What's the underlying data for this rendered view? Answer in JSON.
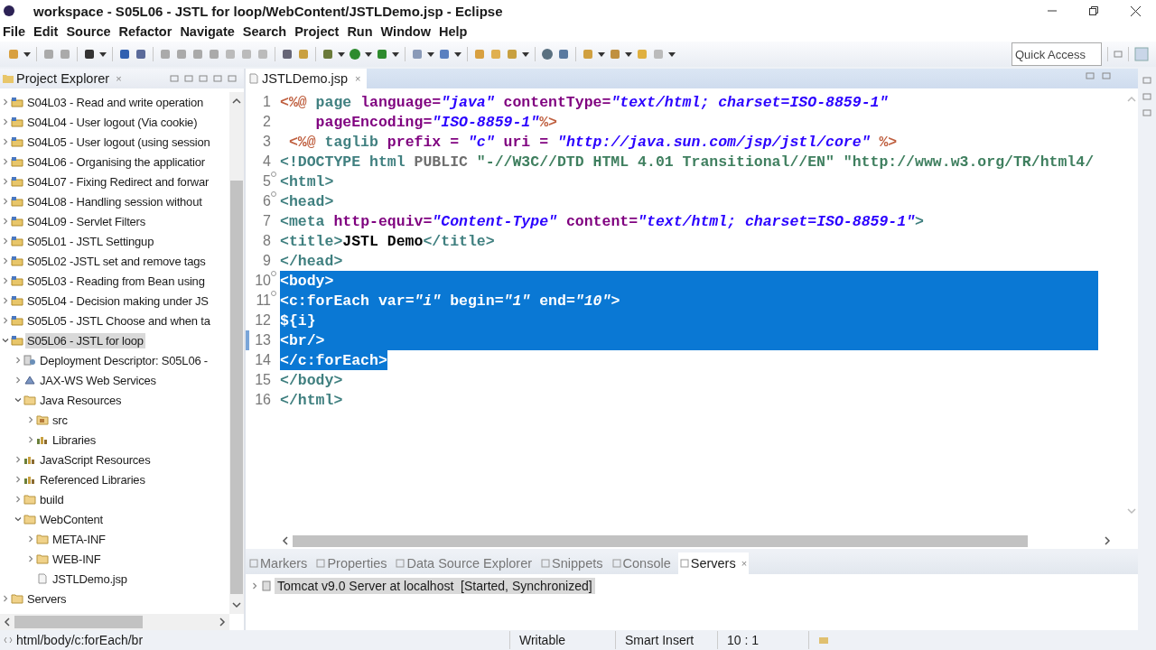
{
  "window": {
    "title": "workspace - S05L06 - JSTL for loop/WebContent/JSTLDemo.jsp - Eclipse"
  },
  "menu": [
    "File",
    "Edit",
    "Source",
    "Refactor",
    "Navigate",
    "Search",
    "Project",
    "Run",
    "Window",
    "Help"
  ],
  "quick_access": {
    "placeholder": "Quick Access"
  },
  "project_explorer": {
    "title": "Project Explorer",
    "close": "×",
    "items": [
      {
        "label": "S04L03 - Read and write operation",
        "kind": "project",
        "expanded": false,
        "selected": false
      },
      {
        "label": "S04L04 - User logout (Via cookie)",
        "kind": "project",
        "expanded": false,
        "selected": false
      },
      {
        "label": "S04L05 - User logout (using session",
        "kind": "project",
        "expanded": false,
        "selected": false
      },
      {
        "label": "S04L06 - Organising the applicatior",
        "kind": "project",
        "expanded": false,
        "selected": false
      },
      {
        "label": "S04L07 - Fixing Redirect and forwar",
        "kind": "project",
        "expanded": false,
        "selected": false
      },
      {
        "label": "S04L08 - Handling session without",
        "kind": "project",
        "expanded": false,
        "selected": false
      },
      {
        "label": "S04L09 - Servlet Filters",
        "kind": "project",
        "expanded": false,
        "selected": false
      },
      {
        "label": "S05L01 - JSTL Settingup",
        "kind": "project",
        "expanded": false,
        "selected": false
      },
      {
        "label": "S05L02 -JSTL set and remove tags",
        "kind": "project",
        "expanded": false,
        "selected": false
      },
      {
        "label": "S05L03 - Reading from Bean using",
        "kind": "project",
        "expanded": false,
        "selected": false
      },
      {
        "label": "S05L04 - Decision making under JS",
        "kind": "project",
        "expanded": false,
        "selected": false
      },
      {
        "label": "S05L05 - JSTL Choose and when ta",
        "kind": "project",
        "expanded": false,
        "selected": false
      },
      {
        "label": "S05L06 - JSTL for loop",
        "kind": "project",
        "expanded": true,
        "selected": true,
        "children": [
          {
            "label": "Deployment Descriptor: S05L06 -",
            "kind": "descriptor",
            "expanded": false,
            "selected": false
          },
          {
            "label": "JAX-WS Web Services",
            "kind": "service",
            "expanded": false,
            "selected": false
          },
          {
            "label": "Java Resources",
            "kind": "folder",
            "expanded": true,
            "selected": false,
            "children": [
              {
                "label": "src",
                "kind": "package",
                "expanded": false,
                "selected": false
              },
              {
                "label": "Libraries",
                "kind": "library",
                "expanded": false,
                "selected": false
              }
            ]
          },
          {
            "label": "JavaScript Resources",
            "kind": "library",
            "expanded": false,
            "selected": false
          },
          {
            "label": "Referenced Libraries",
            "kind": "library",
            "expanded": false,
            "selected": false
          },
          {
            "label": "build",
            "kind": "folder",
            "expanded": false,
            "selected": false
          },
          {
            "label": "WebContent",
            "kind": "folder",
            "expanded": true,
            "selected": false,
            "children": [
              {
                "label": "META-INF",
                "kind": "folder",
                "expanded": false,
                "selected": false
              },
              {
                "label": "WEB-INF",
                "kind": "folder",
                "expanded": false,
                "selected": false
              },
              {
                "label": "JSTLDemo.jsp",
                "kind": "file",
                "selected": false
              }
            ]
          }
        ]
      },
      {
        "label": "Servers",
        "kind": "folder",
        "expanded": false,
        "selected": false
      }
    ]
  },
  "editor": {
    "tab": "JSTLDemo.jsp",
    "close": "×",
    "lines": [
      {
        "n": "1",
        "selected": false,
        "marked": false,
        "foldable": false,
        "tokens": [
          {
            "t": "<%@ ",
            "kind": "delim"
          },
          {
            "t": "page ",
            "kind": "name"
          },
          {
            "t": "language=",
            "kind": "attr"
          },
          {
            "t": "\"java\" ",
            "kind": "value"
          },
          {
            "t": "contentType=",
            "kind": "attr"
          },
          {
            "t": "\"text/html; charset=ISO-8859-1\"",
            "kind": "value"
          }
        ]
      },
      {
        "n": "2",
        "selected": false,
        "marked": false,
        "foldable": false,
        "tokens": [
          {
            "t": "    pageEncoding=",
            "kind": "attr"
          },
          {
            "t": "\"ISO-8859-1\"",
            "kind": "value"
          },
          {
            "t": "%>",
            "kind": "delim"
          }
        ]
      },
      {
        "n": "3",
        "selected": false,
        "marked": false,
        "foldable": false,
        "tokens": [
          {
            "t": " <%@ ",
            "kind": "delim"
          },
          {
            "t": "taglib ",
            "kind": "name"
          },
          {
            "t": "prefix = ",
            "kind": "attr"
          },
          {
            "t": "\"c\" ",
            "kind": "value"
          },
          {
            "t": "uri = ",
            "kind": "attr"
          },
          {
            "t": "\"http://java.sun.com/jsp/jstl/core\" ",
            "kind": "value"
          },
          {
            "t": "%>",
            "kind": "delim"
          }
        ]
      },
      {
        "n": "4",
        "selected": false,
        "marked": false,
        "foldable": false,
        "tokens": [
          {
            "t": "<!DOCTYPE html ",
            "kind": "tag"
          },
          {
            "t": "PUBLIC ",
            "kind": "plain"
          },
          {
            "t": "\"-//W3C//DTD HTML 4.01 Transitional//EN\" \"http://www.w3.org/TR/html4/",
            "kind": "doc"
          }
        ]
      },
      {
        "n": "5",
        "selected": false,
        "marked": false,
        "foldable": true,
        "tokens": [
          {
            "t": "<html>",
            "kind": "tag"
          }
        ]
      },
      {
        "n": "6",
        "selected": false,
        "marked": false,
        "foldable": true,
        "tokens": [
          {
            "t": "<head>",
            "kind": "tag"
          }
        ]
      },
      {
        "n": "7",
        "selected": false,
        "marked": false,
        "foldable": false,
        "tokens": [
          {
            "t": "<meta ",
            "kind": "tag"
          },
          {
            "t": "http-equiv=",
            "kind": "attr"
          },
          {
            "t": "\"Content-Type\" ",
            "kind": "value"
          },
          {
            "t": "content=",
            "kind": "attr"
          },
          {
            "t": "\"text/html; charset=ISO-8859-1\"",
            "kind": "value"
          },
          {
            "t": ">",
            "kind": "tag"
          }
        ]
      },
      {
        "n": "8",
        "selected": false,
        "marked": false,
        "foldable": false,
        "tokens": [
          {
            "t": "<title>",
            "kind": "tag"
          },
          {
            "t": "JSTL Demo",
            "kind": "text"
          },
          {
            "t": "</title>",
            "kind": "tag"
          }
        ]
      },
      {
        "n": "9",
        "selected": false,
        "marked": false,
        "foldable": false,
        "tokens": [
          {
            "t": "</head>",
            "kind": "tag"
          }
        ]
      },
      {
        "n": "10",
        "selected": true,
        "marked": false,
        "foldable": true,
        "tokens": [
          {
            "t": "<body>",
            "kind": "tag"
          }
        ]
      },
      {
        "n": "11",
        "selected": true,
        "marked": false,
        "foldable": true,
        "tokens": [
          {
            "t": "<c:forEach ",
            "kind": "tag"
          },
          {
            "t": "var=",
            "kind": "attr"
          },
          {
            "t": "\"i\" ",
            "kind": "value"
          },
          {
            "t": "begin=",
            "kind": "attr"
          },
          {
            "t": "\"1\" ",
            "kind": "value"
          },
          {
            "t": "end=",
            "kind": "attr"
          },
          {
            "t": "\"10\"",
            "kind": "value"
          },
          {
            "t": ">",
            "kind": "tag"
          }
        ]
      },
      {
        "n": "12",
        "selected": true,
        "marked": false,
        "foldable": false,
        "tokens": [
          {
            "t": "${i}",
            "kind": "text"
          }
        ]
      },
      {
        "n": "13",
        "selected": true,
        "marked": true,
        "foldable": false,
        "tokens": [
          {
            "t": "<br/>",
            "kind": "tag"
          }
        ]
      },
      {
        "n": "14",
        "selected": true,
        "marked": false,
        "foldable": false,
        "tokens": [
          {
            "t": "</c:forEach>",
            "kind": "tag"
          }
        ]
      },
      {
        "n": "15",
        "selected": false,
        "marked": false,
        "foldable": false,
        "tokens": [
          {
            "t": "</body>",
            "kind": "tag"
          }
        ]
      },
      {
        "n": "16",
        "selected": false,
        "marked": false,
        "foldable": false,
        "tokens": [
          {
            "t": "</html>",
            "kind": "tag"
          }
        ]
      }
    ]
  },
  "bottom_panel": {
    "tabs": [
      {
        "label": "Markers",
        "selected": false
      },
      {
        "label": "Properties",
        "selected": false
      },
      {
        "label": "Data Source Explorer",
        "selected": false
      },
      {
        "label": "Snippets",
        "selected": false
      },
      {
        "label": "Console",
        "selected": false
      },
      {
        "label": "Servers",
        "selected": true
      }
    ],
    "close": "×",
    "servers": [
      {
        "label": "Tomcat v9.0 Server at localhost  [Started, Synchronized]",
        "selected": true
      }
    ]
  },
  "status_bar": {
    "path": "html/body/c:forEach/br",
    "mode": "Writable",
    "insert": "Smart Insert",
    "position": "10 : 1"
  }
}
